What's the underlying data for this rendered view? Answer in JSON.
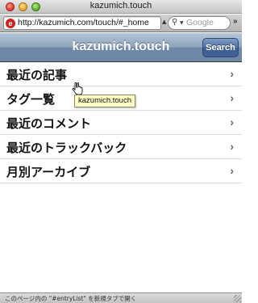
{
  "window": {
    "title": "kazumich.touch"
  },
  "toolbar": {
    "site_icon_glyph": "e",
    "url": "http://kazumich.com/touch/#_home",
    "search_placeholder": "Google",
    "overflow_glyph": "»"
  },
  "app": {
    "title": "kazumich.touch",
    "search_label": "Search",
    "header_color": "#6d87a5"
  },
  "menu": [
    {
      "label": "最近の記事"
    },
    {
      "label": "タグ一覧"
    },
    {
      "label": "最近のコメント"
    },
    {
      "label": "最近のトラックバック"
    },
    {
      "label": "月別アーカイブ"
    }
  ],
  "chevron_glyph": "›",
  "tooltip": {
    "text": "kazumich.touch"
  },
  "status": {
    "text": "このページ内の \"#entryList\" を新規タブで開く"
  }
}
